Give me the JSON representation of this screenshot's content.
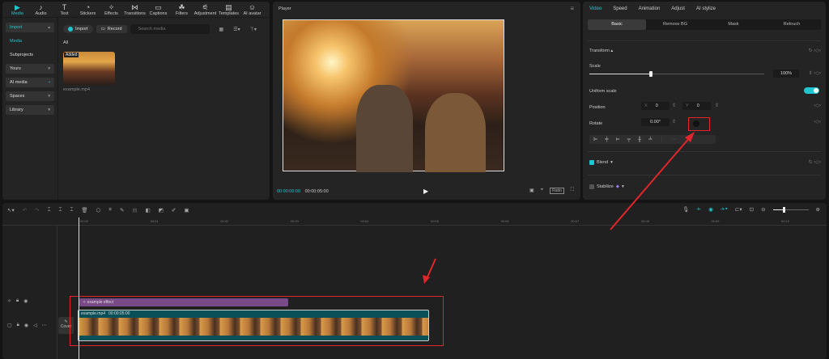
{
  "media_panel": {
    "tabs": [
      {
        "label": "Media",
        "icon": "media-icon"
      },
      {
        "label": "Audio",
        "icon": "audio-icon"
      },
      {
        "label": "Text",
        "icon": "text-icon"
      },
      {
        "label": "Stickers",
        "icon": "stickers-icon"
      },
      {
        "label": "Effects",
        "icon": "effects-icon"
      },
      {
        "label": "Transitions",
        "icon": "transitions-icon"
      },
      {
        "label": "Captions",
        "icon": "captions-icon"
      },
      {
        "label": "Filters",
        "icon": "filters-icon"
      },
      {
        "label": "Adjustment",
        "icon": "adjustment-icon"
      },
      {
        "label": "Templates",
        "icon": "templates-icon"
      },
      {
        "label": "AI avatar",
        "icon": "ai-avatar-icon"
      }
    ],
    "sidebar": [
      {
        "label": "Import"
      },
      {
        "label": "Media"
      },
      {
        "label": "Subprojects"
      },
      {
        "label": "Yours"
      },
      {
        "label": "AI media"
      },
      {
        "label": "Spaces"
      },
      {
        "label": "Library"
      }
    ],
    "import_label": "Import",
    "record_label": "Record",
    "search_placeholder": "Search media",
    "filter_label": "All",
    "item": {
      "badge": "Added",
      "name": "example.mp4"
    }
  },
  "player": {
    "title": "Player",
    "current_time": "00:00:00:00",
    "total_time": "00:00:05:00",
    "ratio_label": "Ratio"
  },
  "properties": {
    "tabs": [
      "Video",
      "Speed",
      "Animation",
      "Adjust",
      "AI stylize"
    ],
    "subtabs": [
      "Basic",
      "Remove BG",
      "Mask",
      "Retouch"
    ],
    "transform": "Transform",
    "scale_label": "Scale",
    "scale_value": "100%",
    "scale_fraction": 0.35,
    "uniform_scale": "Uniform scale",
    "uniform_on": true,
    "position": "Position",
    "x_label": "X",
    "x_value": "0",
    "y_label": "Y",
    "y_value": "0",
    "rotate": "Rotate",
    "rotate_value": "0.00°",
    "blend": "Blend",
    "blend_checked": true,
    "stabilize": "Stabilize",
    "stabilize_checked": false
  },
  "timeline": {
    "ruler": [
      "00:00",
      "00:01",
      "00:02",
      "00:03",
      "00:04",
      "00:05",
      "00:06",
      "00:07",
      "00:08",
      "00:09",
      "00:10"
    ],
    "effect_clip": "example effect",
    "video_clip": {
      "name": "example.mp4",
      "duration": "00:00:05:00"
    },
    "cover_label": "Cover",
    "zoom_fraction": 0.3
  },
  "colors": {
    "accent": "#1fc6d0",
    "effect": "#7a4a88",
    "clip": "#0a5058",
    "annotation": "#e0262b"
  }
}
